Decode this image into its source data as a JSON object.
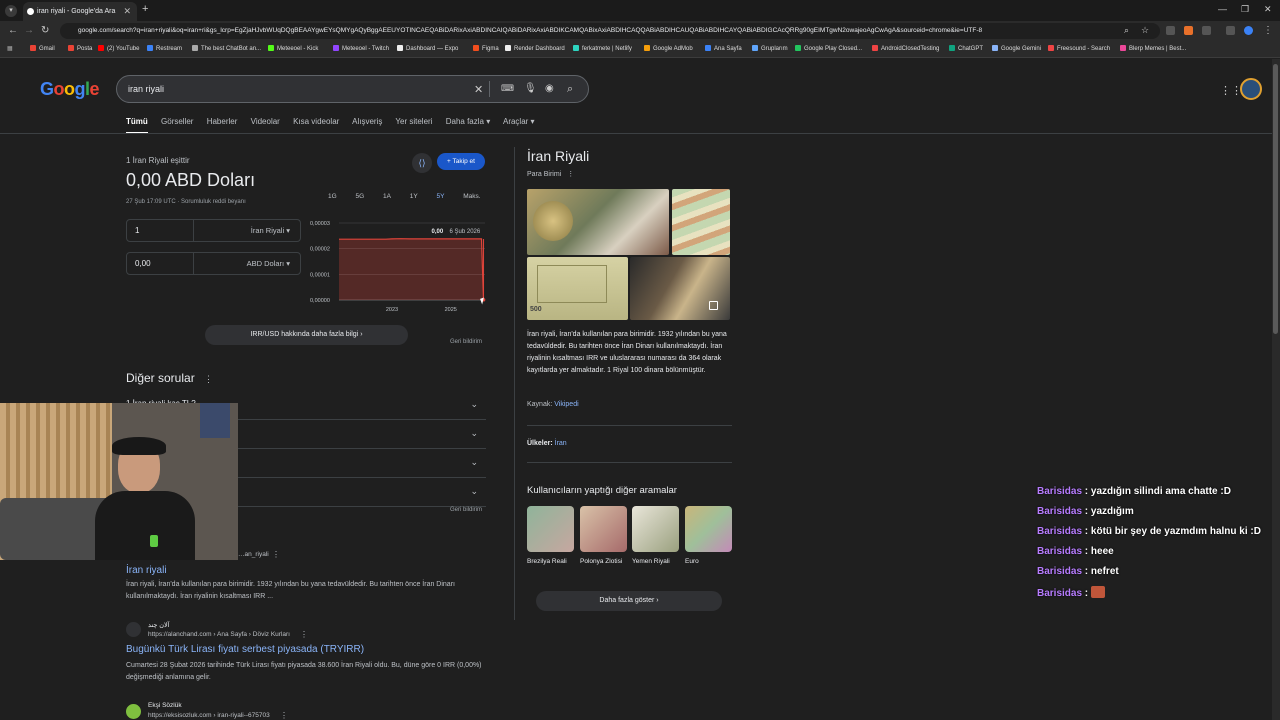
{
  "browser": {
    "tab_title": "iran riyali - Google'da Ara",
    "url": "google.com/search?q=iran+riyali&oq=iran+ri&gs_lcrp=EgZjaHJvbWUqDQgBEAAYgwEYsQMYgAQyBggAEEUYOTINCAEQABiDARixAxiABDINCAIQABiDARixAxiABDIKCAMQABixAxiABDIHCAQQABiABDIHCAUQABiABDIHCAYQABiABDIGCAcQRRg90gEIMTgwN2owajeoAgCwAgA&sourceid=chrome&ie=UTF-8",
    "bookmarks": [
      "Gmail",
      "Posta",
      "(2) YouTube",
      "Restream",
      "The best ChatBot an...",
      "Meteeoel - Kick",
      "Meteeoel - Twitch",
      "Dashboard — Expo",
      "Figma",
      "Render Dashboard",
      "ferkatmete | Netlify",
      "Google AdMob",
      "Ana Sayfa",
      "Gruplarım",
      "Google Play Closed...",
      "AndroidClosedTesting",
      "ChatGPT",
      "Google Gemini",
      "Freesound - Search",
      "Blerp Memes | Best..."
    ],
    "bookmark_colors": [
      "#ea4335",
      "#ea4335",
      "#ff0000",
      "#3b82f6",
      "#aaa",
      "#53fc18",
      "#9146ff",
      "#eee",
      "#f24e1e",
      "#eee",
      "#2dd4bf",
      "#f59e0b",
      "#3b82f6",
      "#60a5fa",
      "#22c55e",
      "#ef4444",
      "#10a37f",
      "#8ab4f8",
      "#ef4444",
      "#ec4899"
    ]
  },
  "search": {
    "logo": "Google",
    "query": "iran riyali",
    "tabs": [
      "Tümü",
      "Görseller",
      "Haberler",
      "Videolar",
      "Kısa videolar",
      "Alışveriş",
      "Yer siteleri",
      "Daha fazla ▾",
      "Araçlar ▾"
    ]
  },
  "converter": {
    "label": "1 İran Riyali eşittir",
    "value": "0,00 ABD Doları",
    "date": "27 Şub 17:09 UTC · Sorumluluk reddi beyanı",
    "share_icon": "share-icon",
    "follow": "+ Takip et",
    "from_amount": "1",
    "from_currency": "İran Riyali",
    "to_amount": "0,00",
    "to_currency": "ABD Doları",
    "ranges": [
      "1G",
      "5G",
      "1A",
      "1Y",
      "5Y",
      "Maks."
    ],
    "selected_range": "5Y",
    "more_info": "IRR/USD hakkında daha fazla bilgi  ›",
    "feedback": "Geri bildirim"
  },
  "chart_data": {
    "type": "line",
    "title": "",
    "xlabel": "",
    "ylabel": "",
    "y_tick_labels": [
      "0,00003",
      "0,00002",
      "0,00001",
      "0,00000"
    ],
    "y_ticks": [
      3e-05,
      2e-05,
      1e-05,
      0
    ],
    "x_tick_labels": [
      "2023",
      "2025"
    ],
    "x_ticks": [
      2023,
      2025
    ],
    "xlim": [
      2021.2,
      2026.17
    ],
    "ylim": [
      0,
      3e-05
    ],
    "x": [
      2021.2,
      2022.0,
      2022.8,
      2023.0,
      2023.3,
      2023.6,
      2024.0,
      2024.5,
      2025.0,
      2025.6,
      2026.05,
      2026.12,
      2026.17
    ],
    "y": [
      2.37e-05,
      2.37e-05,
      2.37e-05,
      2.38e-05,
      2.39e-05,
      2.38e-05,
      2.38e-05,
      2.38e-05,
      2.38e-05,
      2.38e-05,
      2.38e-05,
      1e-07,
      1e-07
    ],
    "hover_value": "0,00",
    "hover_date": "6 Şub 2026",
    "grid": true,
    "color": "#e0443a"
  },
  "paa": {
    "title": "Diğer sorular",
    "partial_question": "1 İran riyali kaç TL?",
    "feedback": "Geri bildirim"
  },
  "results": [
    {
      "site": "…an_riyali",
      "title": "İran riyali",
      "snippet": "İran riyali, İran'da kullanılan para birimidir. 1932 yılından bu yana tedavüldedir. Bu tarihten önce İran Dinarı kullanılmaktaydı. İran riyalinin kısaltması IRR ..."
    },
    {
      "site_name": "آلان چند",
      "site": "https://alanchand.com › Ana Sayfa › Döviz Kurları",
      "title": "Bugünkü Türk Lirası fiyatı serbest piyasada (TRYIRR)",
      "snippet": "Cumartesi 28 Şubat 2026 tarihinde Türk Lirası fiyatı piyasada 38.600 İran Riyali oldu. Bu, düne göre 0 IRR (0,00%) değişmediği anlamına gelir."
    },
    {
      "site_name": "Ekşi Sözlük",
      "site": "https://eksisozluk.com › iran-riyali--675703"
    }
  ],
  "knowledge": {
    "title": "İran Riyali",
    "subtitle": "Para Birimi",
    "description": "İran riyali, İran'da kullanılan para birimidir. 1932 yılından bu yana tedavüldedir. Bu tarihten önce İran Dinarı kullanılmaktaydı. İran riyalinin kısaltması IRR ve uluslararası numarası da 364 olarak kayıtlarda yer almaktadır. 1 Riyal 100 dinara bölünmüştür.",
    "source_label": "Kaynak:",
    "source": "Vikipedi",
    "countries_label": "Ülkeler:",
    "countries": "İran",
    "image_500": "500",
    "related_title": "Kullanıcıların yaptığı diğer aramalar",
    "related": [
      "Brezilya Reali",
      "Polonya Zlotisi",
      "Yemen Riyali",
      "Euro"
    ],
    "show_more": "Daha fazla göster  ›"
  },
  "chat": [
    {
      "user": "Barisidas",
      "msg": "yazdığın silindi ama chatte :D"
    },
    {
      "user": "Barisidas",
      "msg": "yazdığım"
    },
    {
      "user": "Barisidas",
      "msg": "kötü bir şey de yazmdım halnu ki :D"
    },
    {
      "user": "Barisidas",
      "msg": "heee"
    },
    {
      "user": "Barisidas",
      "msg": "nefret"
    },
    {
      "user": "Barisidas",
      "msg": ""
    }
  ]
}
